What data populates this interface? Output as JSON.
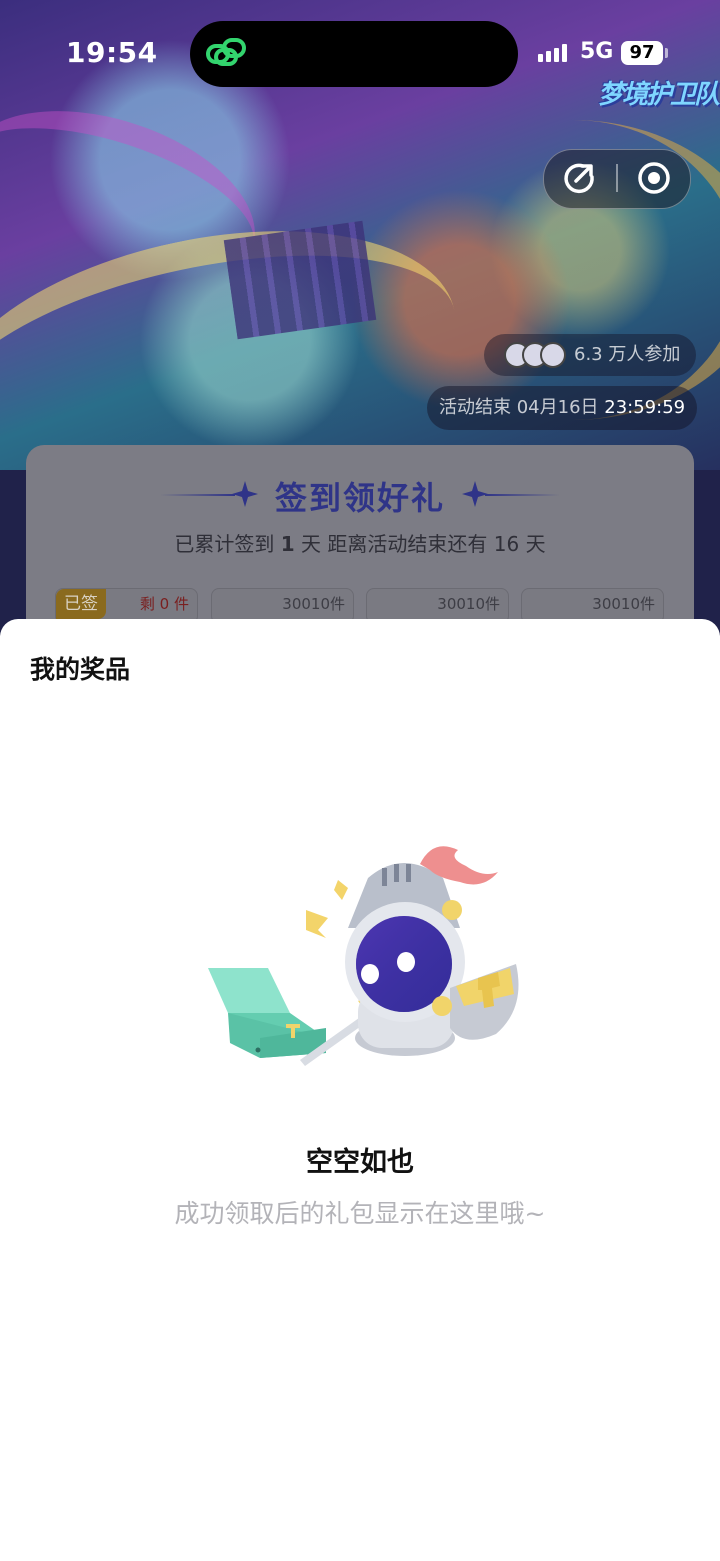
{
  "status_bar": {
    "time": "19:54",
    "network": "5G",
    "battery": "97",
    "island_icon": "link-rings-icon"
  },
  "banner": {
    "game_logo": "梦境护卫队",
    "participants": "6.3 万人参加",
    "deadline_label": "活动结束 04月16日",
    "deadline_time": "23:59:59"
  },
  "capsule": {
    "share_icon": "share-icon",
    "record_icon": "record-icon"
  },
  "card": {
    "title": "签到领好礼",
    "sub_prefix": "已累计签到",
    "sub_days": "1",
    "sub_suffix": "天  距离活动结束还有 16 天",
    "slots": [
      {
        "tag": "已签",
        "text": "剩 0 件"
      },
      {
        "text": "30010件"
      },
      {
        "text": "30010件"
      },
      {
        "text": "30010件"
      }
    ]
  },
  "sheet": {
    "title": "我的奖品",
    "empty_title": "空空如也",
    "empty_desc": "成功领取后的礼包显示在这里哦~"
  },
  "colors": {
    "accent_title": "#2f3488",
    "empty_desc": "#b3b3b8"
  }
}
